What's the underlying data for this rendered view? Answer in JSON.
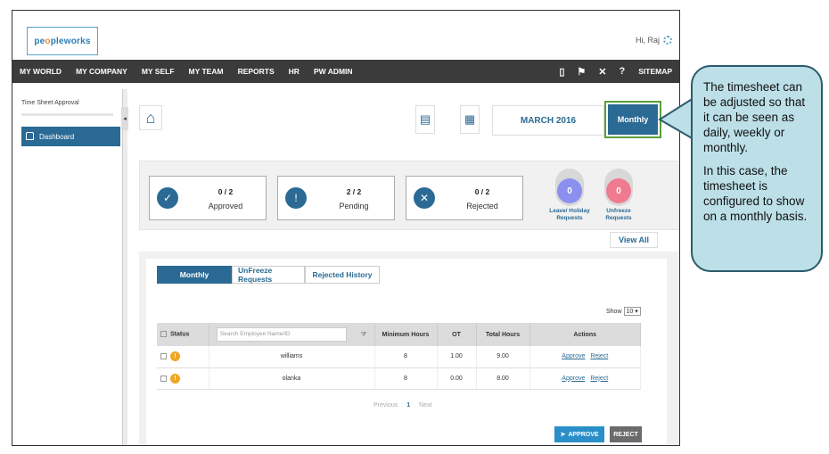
{
  "app": {
    "logo_text_left": "pe",
    "logo_text_o": "o",
    "logo_text_right": "pleworks",
    "greeting": "Hi, Raj"
  },
  "nav": {
    "items": [
      "MY WORLD",
      "MY COMPANY",
      "MY SELF",
      "MY TEAM",
      "REPORTS",
      "HR",
      "PW ADMIN"
    ],
    "sitemap": "SITEMAP"
  },
  "sidebar": {
    "title": "Time Sheet Approval",
    "dashboard": "Dashboard"
  },
  "header": {
    "month": "MARCH 2016",
    "view_mode": "Monthly"
  },
  "summary": {
    "approved": {
      "count": "0 / 2",
      "label": "Approved"
    },
    "pending": {
      "count": "2 / 2",
      "label": "Pending"
    },
    "rejected": {
      "count": "0 / 2",
      "label": "Rejected"
    },
    "leave": {
      "count": "0",
      "label_line1": "Leave/ Holiday",
      "label_line2": "Requests",
      "color": "#8b8ff0"
    },
    "unfreeze": {
      "count": "0",
      "label_line1": "Unfreeze",
      "label_line2": "Requests",
      "color": "#f07a90"
    },
    "view_all": "View All"
  },
  "tabs": [
    "Monthly",
    "UnFreeze Requests",
    "Rejected History"
  ],
  "show": {
    "label": "Show",
    "value": "10"
  },
  "table": {
    "headers": {
      "status": "Status",
      "search_placeholder": "Search Employee Name/ID",
      "min_hours": "Minimum Hours",
      "ot": "OT",
      "total_hours": "Total Hours",
      "actions": "Actions"
    },
    "rows": [
      {
        "name": "williams",
        "min_hours": "8",
        "ot": "1.00",
        "total": "9.00",
        "approve": "Approve",
        "reject": "Reject"
      },
      {
        "name": "olanka",
        "min_hours": "8",
        "ot": "0.00",
        "total": "8.00",
        "approve": "Approve",
        "reject": "Reject"
      }
    ]
  },
  "pager": {
    "previous": "Previous",
    "page": "1",
    "next": "Next"
  },
  "buttons": {
    "approve": "APPROVE",
    "reject": "REJECT"
  },
  "callout": {
    "p1": "The timesheet can be adjusted so that it can be seen as daily, weekly or monthly.",
    "p2": "In this case, the timesheet is configured to show on a monthly basis."
  }
}
